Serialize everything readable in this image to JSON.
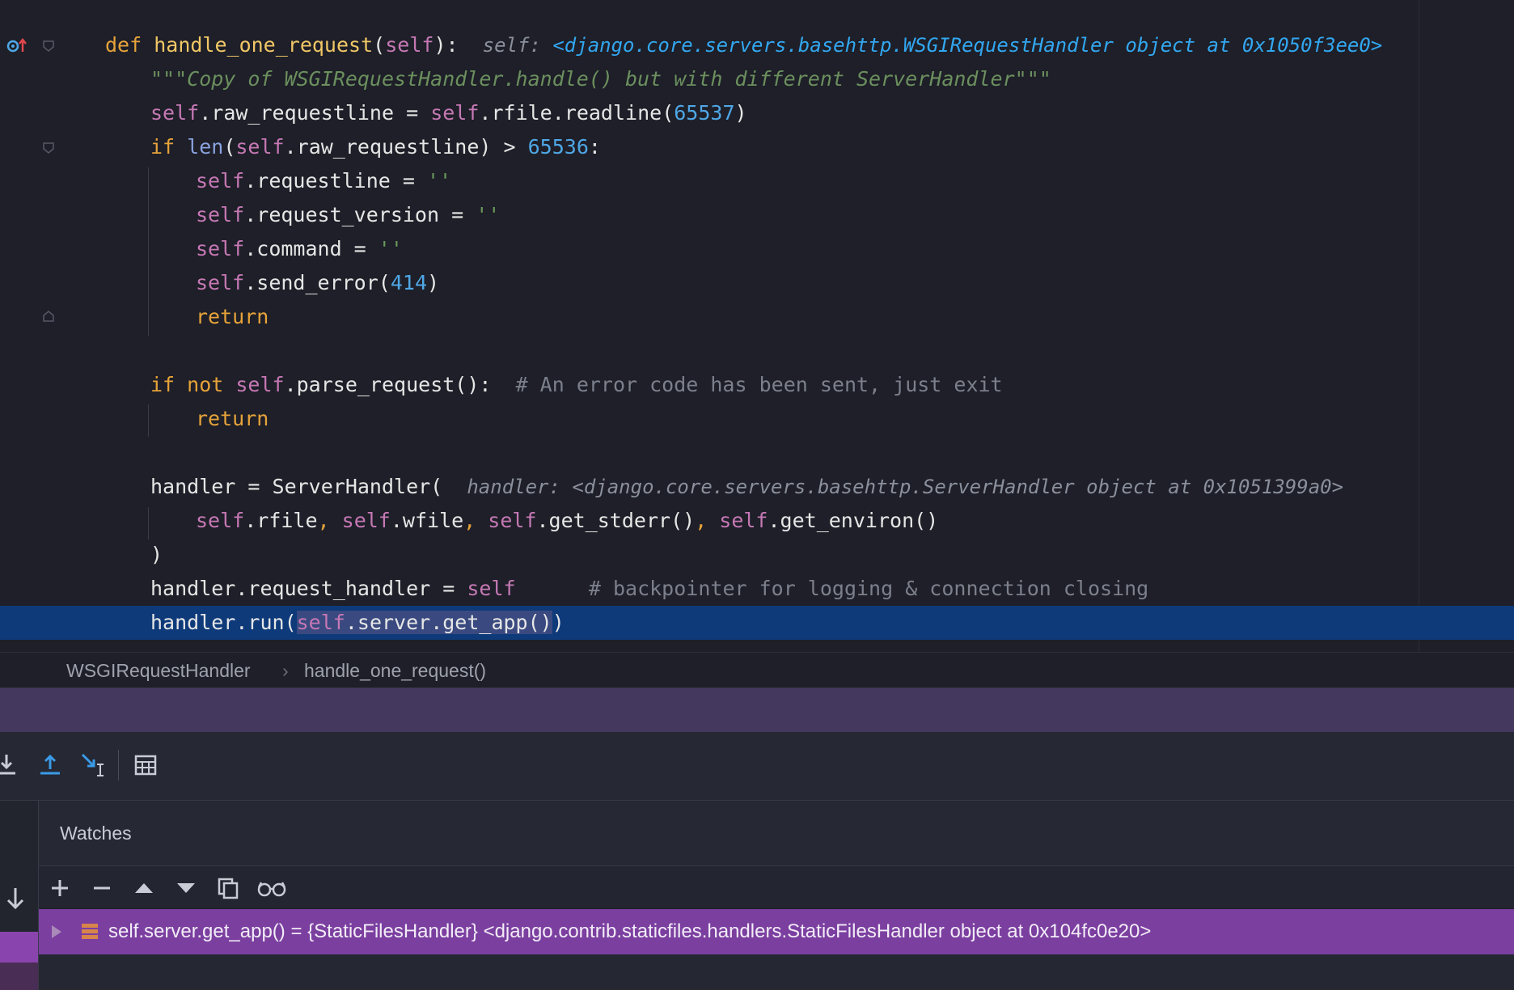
{
  "editor": {
    "lines": [
      {
        "id": "l1",
        "segments": [
          [
            "kw",
            "def "
          ],
          [
            "fn",
            "handle_one_request"
          ],
          [
            "punc",
            "("
          ],
          [
            "slf",
            "self"
          ],
          [
            "punc",
            "):  "
          ],
          [
            "inl",
            "self: "
          ],
          [
            "inl-blue",
            "<django.core.servers.basehttp.WSGIRequestHandler object at 0x1050f3ee0>"
          ]
        ]
      },
      {
        "id": "l2",
        "segments": [
          [
            "doc",
            "\"\"\"Copy of WSGIRequestHandler.handle() but with different ServerHandler\"\"\""
          ]
        ]
      },
      {
        "id": "l3",
        "segments": [
          [
            "slf",
            "self"
          ],
          [
            "punc",
            ".raw_requestline = "
          ],
          [
            "slf",
            "self"
          ],
          [
            "punc",
            ".rfile.readline("
          ],
          [
            "num",
            "65537"
          ],
          [
            "punc",
            ")"
          ]
        ]
      },
      {
        "id": "l4",
        "segments": [
          [
            "kw",
            "if "
          ],
          [
            "builtin",
            "len"
          ],
          [
            "punc",
            "("
          ],
          [
            "slf",
            "self"
          ],
          [
            "punc",
            ".raw_requestline) > "
          ],
          [
            "num",
            "65536"
          ],
          [
            "punc",
            ":"
          ]
        ]
      },
      {
        "id": "l5",
        "segments": [
          [
            "slf",
            "self"
          ],
          [
            "punc",
            ".requestline = "
          ],
          [
            "str",
            "''"
          ]
        ]
      },
      {
        "id": "l6",
        "segments": [
          [
            "slf",
            "self"
          ],
          [
            "punc",
            ".request_version = "
          ],
          [
            "str",
            "''"
          ]
        ]
      },
      {
        "id": "l7",
        "segments": [
          [
            "slf",
            "self"
          ],
          [
            "punc",
            ".command = "
          ],
          [
            "str",
            "''"
          ]
        ]
      },
      {
        "id": "l8",
        "segments": [
          [
            "slf",
            "self"
          ],
          [
            "punc",
            ".send_error("
          ],
          [
            "num",
            "414"
          ],
          [
            "punc",
            ")"
          ]
        ]
      },
      {
        "id": "l9",
        "segments": [
          [
            "kw",
            "return"
          ]
        ]
      },
      {
        "id": "l10",
        "segments": []
      },
      {
        "id": "l11",
        "segments": [
          [
            "kw",
            "if not "
          ],
          [
            "slf",
            "self"
          ],
          [
            "punc",
            ".parse_request():  "
          ],
          [
            "cmt",
            "# An error code has been sent, just exit"
          ]
        ]
      },
      {
        "id": "l12",
        "segments": [
          [
            "kw",
            "return"
          ]
        ]
      },
      {
        "id": "l13",
        "segments": []
      },
      {
        "id": "l14",
        "segments": [
          [
            "punc",
            "handler = ServerHandler(  "
          ],
          [
            "inl",
            "handler: <django.core.servers.basehttp.ServerHandler object at 0x1051399a0>"
          ]
        ]
      },
      {
        "id": "l15",
        "segments": [
          [
            "slf",
            "self"
          ],
          [
            "punc",
            ".rfile"
          ],
          [
            "kw",
            ", "
          ],
          [
            "slf",
            "self"
          ],
          [
            "punc",
            ".wfile"
          ],
          [
            "kw",
            ", "
          ],
          [
            "slf",
            "self"
          ],
          [
            "punc",
            ".get_stderr()"
          ],
          [
            "kw",
            ", "
          ],
          [
            "slf",
            "self"
          ],
          [
            "punc",
            ".get_environ()"
          ]
        ]
      },
      {
        "id": "l16",
        "segments": [
          [
            "punc",
            ")"
          ]
        ]
      },
      {
        "id": "l17",
        "segments": [
          [
            "punc",
            "handler.request_handler = "
          ],
          [
            "slf",
            "self"
          ],
          [
            "punc",
            "      "
          ],
          [
            "cmt",
            "# backpointer for logging & connection closing"
          ]
        ]
      },
      {
        "id": "l18",
        "segments": [
          [
            "punc",
            "handler.run("
          ],
          [
            "slf sel",
            "self"
          ],
          [
            "punc sel",
            ".server.get_app()"
          ],
          [
            "punc",
            ")"
          ]
        ]
      }
    ]
  },
  "breadcrumb": {
    "class_name": "WSGIRequestHandler",
    "separator": "›",
    "method_name": "handle_one_request()"
  },
  "watches": {
    "title": "Watches",
    "items": [
      {
        "expression": "self.server.get_app() = {StaticFilesHandler} <django.contrib.staticfiles.handlers.StaticFilesHandler object at 0x104fc0e20>"
      }
    ]
  },
  "icons": {
    "gutter_override": "override-up-icon",
    "breakpoint": "breakpoint-icon",
    "step_into": "step-into-icon",
    "step_out": "step-out-icon",
    "run_to_cursor": "run-to-cursor-icon",
    "evaluate_table": "table-icon",
    "add_watch": "plus-icon",
    "remove_watch": "minus-icon",
    "move_up": "triangle-up-icon",
    "move_down": "triangle-down-icon",
    "duplicate": "copy-icon",
    "inline_watch": "glasses-icon",
    "collapse_down": "arrow-down-icon",
    "expand": "triangle-right-icon",
    "object_type": "object-stack-icon"
  },
  "colors": {
    "editor_bg": "#1e1f28",
    "current_line": "#0e3a7a",
    "keyword": "#e6a33a",
    "self": "#c678b5",
    "number": "#4fa7e6",
    "watch_row": "#7b3fa0",
    "breakpoint": "#e0474c"
  }
}
